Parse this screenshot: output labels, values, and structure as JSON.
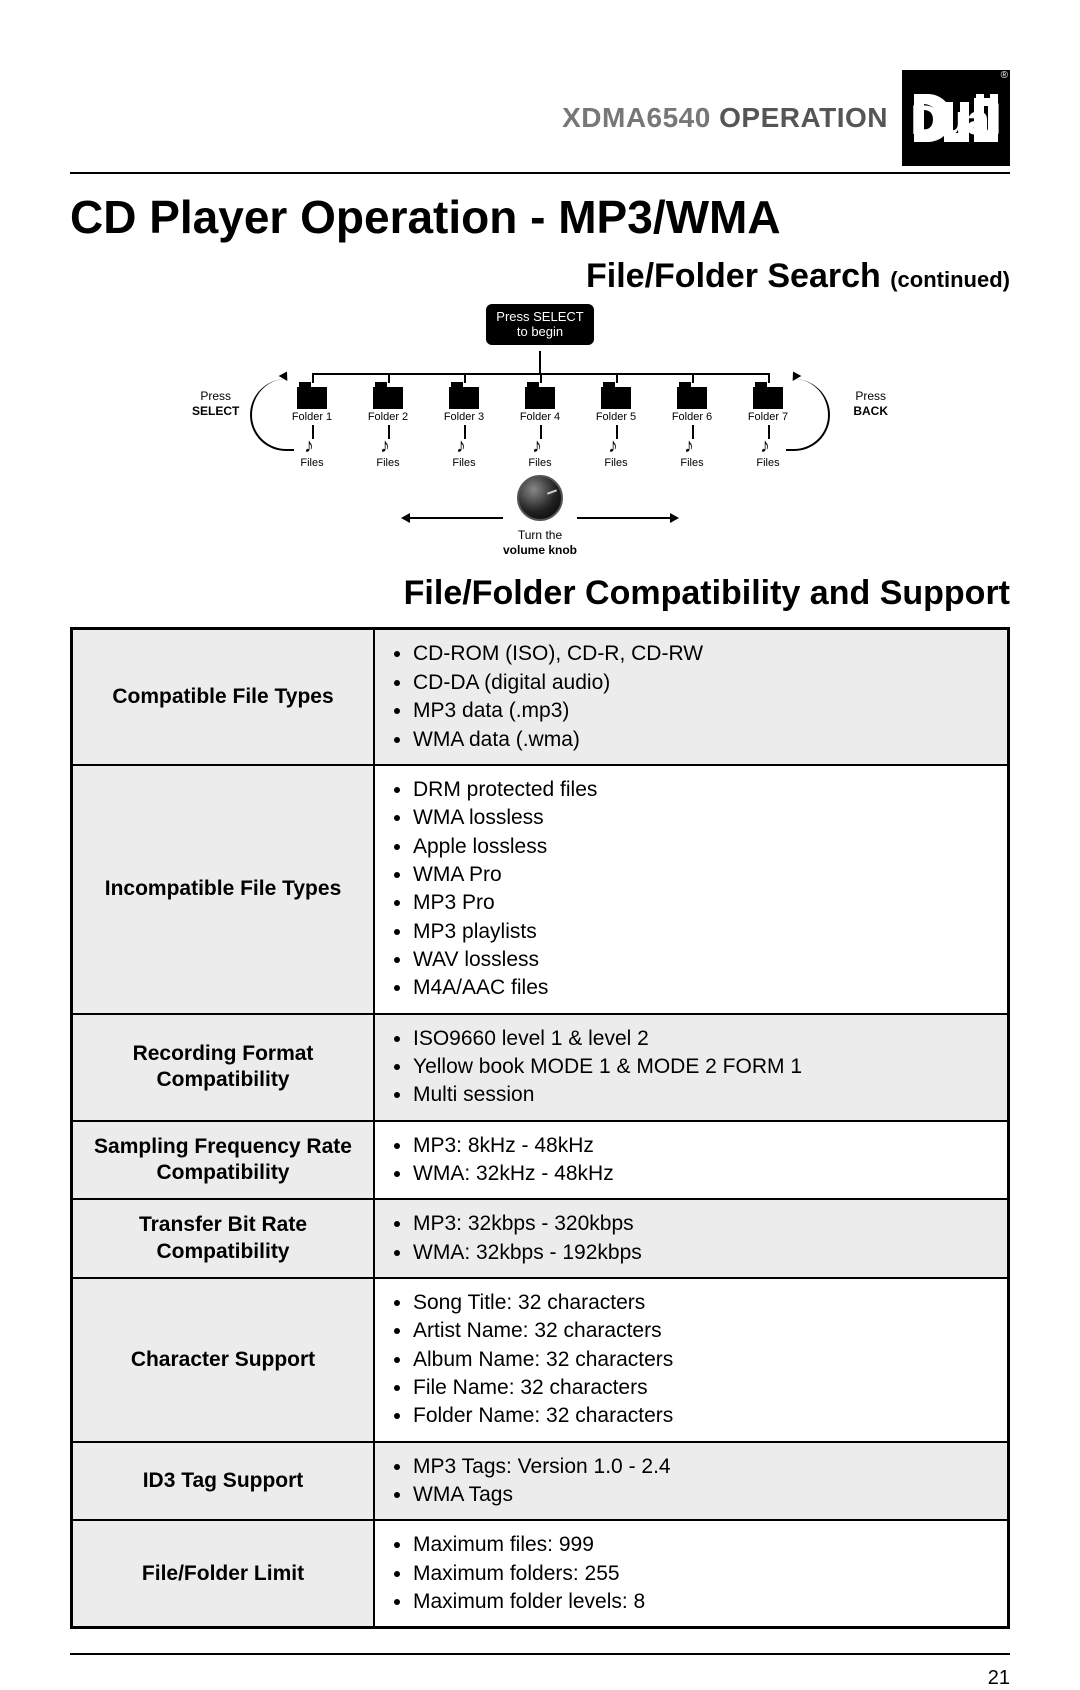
{
  "header": {
    "model": "XDMA6540",
    "word": "OPERATION",
    "logo_text": "Dual"
  },
  "title": "CD Player Operation - MP3/WMA",
  "subhead": {
    "main": "File/Folder Search",
    "cont": "(continued)"
  },
  "diagram": {
    "select_box_l1": "Press SELECT",
    "select_box_l2": "to begin",
    "folders": [
      "Folder 1",
      "Folder 2",
      "Folder 3",
      "Folder 4",
      "Folder 5",
      "Folder 6",
      "Folder 7"
    ],
    "files_label": "Files",
    "left_side_l1": "Press",
    "left_side_l2": "SELECT",
    "right_side_l1": "Press",
    "right_side_l2": "BACK",
    "turn_l1": "Turn the",
    "turn_l2": "volume knob"
  },
  "section2": "File/Folder Compatibility and Support",
  "table": {
    "rows": [
      {
        "label": "Compatible File Types",
        "items": [
          "CD-ROM (ISO), CD-R, CD-RW",
          "CD-DA (digital audio)",
          "MP3 data (.mp3)",
          "WMA data (.wma)"
        ],
        "shaded": true
      },
      {
        "label": "Incompatible File Types",
        "items": [
          "DRM protected files",
          "WMA lossless",
          "Apple lossless",
          "WMA Pro",
          "MP3 Pro",
          "MP3 playlists",
          "WAV lossless",
          "M4A/AAC files"
        ],
        "shaded": false
      },
      {
        "label": "Recording Format Compatibility",
        "items": [
          "ISO9660 level 1 & level 2",
          "Yellow book MODE 1 & MODE 2 FORM 1",
          "Multi session"
        ],
        "shaded": true
      },
      {
        "label": "Sampling Frequency Rate Compatibility",
        "items": [
          "MP3: 8kHz - 48kHz",
          "WMA: 32kHz - 48kHz"
        ],
        "shaded": false
      },
      {
        "label": "Transfer Bit Rate Compatibility",
        "items": [
          "MP3: 32kbps - 320kbps",
          "WMA: 32kbps - 192kbps"
        ],
        "shaded": true
      },
      {
        "label": "Character Support",
        "items": [
          "Song Title: 32 characters",
          "Artist Name: 32 characters",
          "Album Name: 32 characters",
          "File Name: 32 characters",
          "Folder Name: 32 characters"
        ],
        "shaded": false
      },
      {
        "label": "ID3 Tag Support",
        "items": [
          "MP3 Tags: Version 1.0 - 2.4",
          "WMA Tags"
        ],
        "shaded": true
      },
      {
        "label": "File/Folder Limit",
        "items": [
          "Maximum files: 999",
          "Maximum folders: 255",
          "Maximum folder levels: 8"
        ],
        "shaded": false
      }
    ]
  },
  "page_number": "21"
}
